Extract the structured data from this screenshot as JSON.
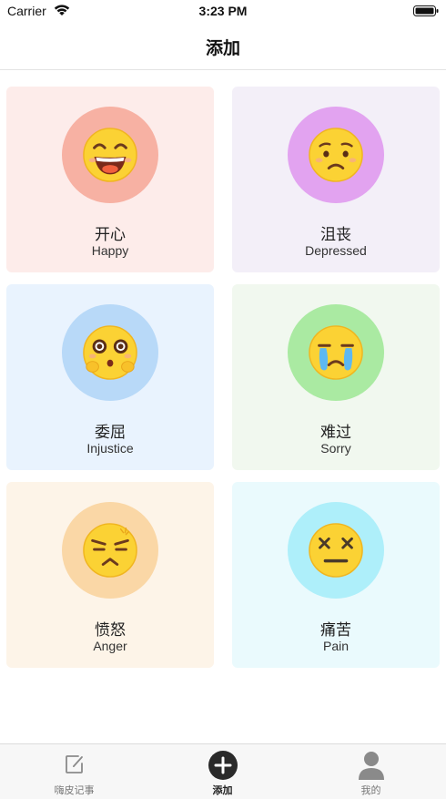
{
  "status_bar": {
    "carrier": "Carrier",
    "time": "3:23 PM"
  },
  "nav": {
    "title": "添加"
  },
  "moods": [
    {
      "cn": "开心",
      "en": "Happy",
      "card_bg": "#fdecea",
      "circle_bg": "#f7b1a3",
      "icon": "happy-face-icon"
    },
    {
      "cn": "沮丧",
      "en": "Depressed",
      "card_bg": "#f3eff8",
      "circle_bg": "#e2a3f0",
      "icon": "depressed-face-icon"
    },
    {
      "cn": "委屈",
      "en": "Injustice",
      "card_bg": "#e9f3fe",
      "circle_bg": "#b8d9f8",
      "icon": "injustice-face-icon"
    },
    {
      "cn": "难过",
      "en": "Sorry",
      "card_bg": "#f1f8ef",
      "circle_bg": "#aaeaa2",
      "icon": "crying-face-icon"
    },
    {
      "cn": "愤怒",
      "en": "Anger",
      "card_bg": "#fdf4e8",
      "circle_bg": "#fad7a6",
      "icon": "angry-face-icon"
    },
    {
      "cn": "痛苦",
      "en": "Pain",
      "card_bg": "#eafafd",
      "circle_bg": "#aeeffa",
      "icon": "pain-face-icon"
    }
  ],
  "tabs": [
    {
      "label": "嗨皮记事",
      "icon": "edit-note-icon",
      "active": false
    },
    {
      "label": "添加",
      "icon": "add-circle-icon",
      "active": true
    },
    {
      "label": "我的",
      "icon": "user-icon",
      "active": false
    }
  ]
}
